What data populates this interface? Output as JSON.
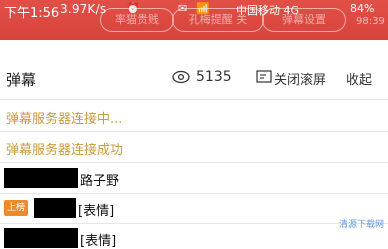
{
  "status_bar": {
    "time": "下午1:56",
    "speed": "3.97K/s",
    "carrier": "中国移动 4G",
    "battery": "84%"
  },
  "header": {
    "pills": [
      "率猫贵贱",
      "孔梅提醒 关",
      "弹幕设置"
    ],
    "counter": "98:39"
  },
  "danmu_panel": {
    "title": "弹幕",
    "view_count": "5135",
    "close_scroll_label": "关闭滚屏",
    "collapse_label": "收起"
  },
  "messages": [
    {
      "type": "system",
      "text": "弹幕服务器连接中..."
    },
    {
      "type": "system",
      "text": "弹幕服务器连接成功"
    },
    {
      "type": "user",
      "text": "路子野"
    },
    {
      "type": "user",
      "badge": "上榜",
      "text": "[表情]"
    },
    {
      "type": "user",
      "text": "[表情]"
    }
  ],
  "watermark": "清源下载网"
}
